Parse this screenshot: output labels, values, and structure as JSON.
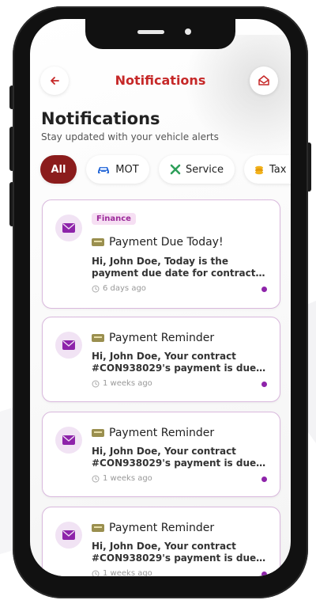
{
  "header": {
    "title": "Notifications"
  },
  "page": {
    "heading": "Notifications",
    "subheading": "Stay updated with your vehicle alerts"
  },
  "filters": [
    {
      "label": "All",
      "icon": "",
      "active": true
    },
    {
      "label": "MOT",
      "icon": "car-icon",
      "active": false
    },
    {
      "label": "Service",
      "icon": "wrench-icon",
      "active": false
    },
    {
      "label": "Tax",
      "icon": "coins-icon",
      "active": false
    }
  ],
  "notifications": [
    {
      "badge": "Finance",
      "title": "Payment Due Today!",
      "message_line1": "Hi, John Doe, Today is the",
      "message_line2": "payment due date for contract #...",
      "time": "6 days ago",
      "unread": true
    },
    {
      "badge": "",
      "title": "Payment Reminder",
      "message_line1": "Hi, John Doe, Your contract",
      "message_line2": "#CON938029's payment is due ...",
      "time": "1 weeks ago",
      "unread": true
    },
    {
      "badge": "",
      "title": "Payment Reminder",
      "message_line1": "Hi, John Doe, Your contract",
      "message_line2": "#CON938029's payment is due ...",
      "time": "1 weeks ago",
      "unread": true
    },
    {
      "badge": "",
      "title": "Payment Reminder",
      "message_line1": "Hi, John Doe, Your contract",
      "message_line2": "#CON938029's payment is due ...",
      "time": "1 weeks ago",
      "unread": true
    }
  ],
  "colors": {
    "accent": "#c62828",
    "active_chip": "#8b1c1c",
    "purple": "#8e24aa"
  }
}
